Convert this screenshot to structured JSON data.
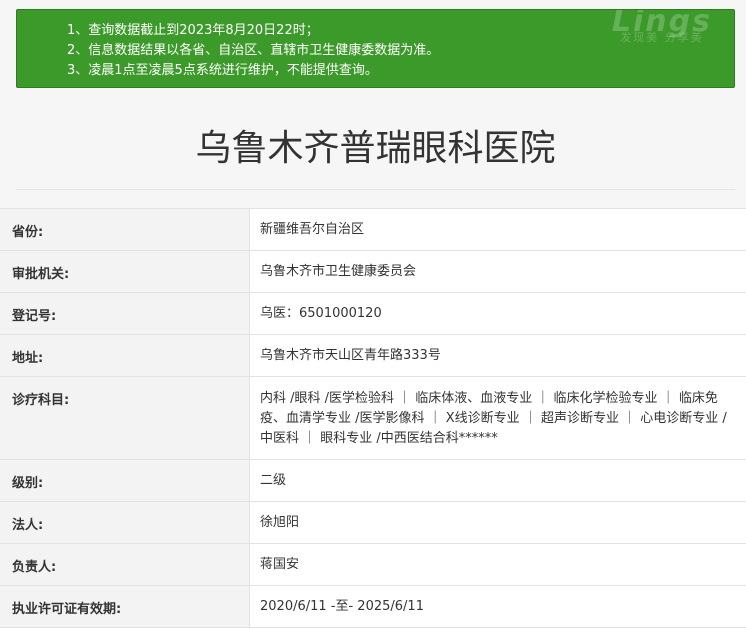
{
  "notice": {
    "lines": [
      "1、查询数据截止到2023年8月20日22时；",
      "2、信息数据结果以各省、自治区、直辖市卫生健康委数据为准。",
      "3、凌晨1点至凌晨5点系统进行维护，不能提供查询。"
    ],
    "watermark_logo": "Lings",
    "watermark_sub": "发现美 分享美"
  },
  "page_title": "乌鲁木齐普瑞眼科医院",
  "rows": [
    {
      "label": "省份:",
      "value": "新疆维吾尔自治区"
    },
    {
      "label": "审批机关:",
      "value": "乌鲁木齐市卫生健康委员会"
    },
    {
      "label": "登记号:",
      "value": "乌医：6501000120"
    },
    {
      "label": "地址:",
      "value": "乌鲁木齐市天山区青年路333号"
    },
    {
      "label": "诊疗科目:",
      "value": "内科 /眼科 /医学检验科 ｜ 临床体液、血液专业 ｜ 临床化学检验专业 ｜ 临床免疫、血清学专业 /医学影像科 ｜ X线诊断专业 ｜ 超声诊断专业 ｜ 心电诊断专业 /中医科 ｜ 眼科专业 /中西医结合科******"
    },
    {
      "label": "级别:",
      "value": "二级"
    },
    {
      "label": "法人:",
      "value": "徐旭阳"
    },
    {
      "label": "负责人:",
      "value": "蒋国安"
    },
    {
      "label": "执业许可证有效期:",
      "value": "2020/6/11 -至- 2025/6/11"
    }
  ],
  "colors": {
    "notice_bg": "#3c9a2a",
    "label_bg": "#f3f3f3",
    "value_bg": "#ffffff"
  }
}
